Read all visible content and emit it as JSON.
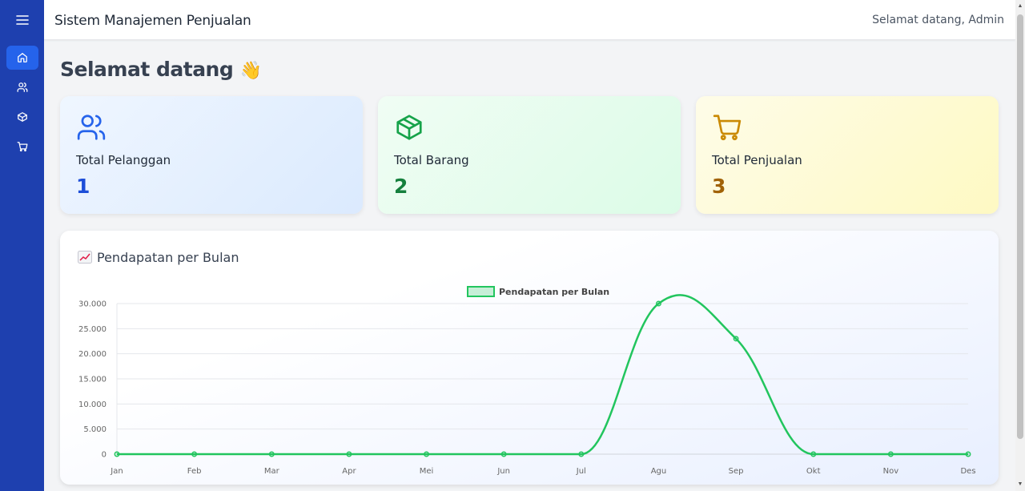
{
  "header": {
    "title": "Sistem Manajemen Penjualan",
    "welcome": "Selamat datang, Admin"
  },
  "page": {
    "title": "Selamat datang",
    "title_emoji": "👋"
  },
  "sidebar": {
    "items": [
      {
        "icon": "home-icon",
        "active": true
      },
      {
        "icon": "users-icon",
        "active": false
      },
      {
        "icon": "box-icon",
        "active": false
      },
      {
        "icon": "cart-icon",
        "active": false
      }
    ]
  },
  "stats": [
    {
      "label": "Total Pelanggan",
      "value": "1",
      "icon": "users-icon",
      "color": "#1d4ed8",
      "icon_color": "#2563eb"
    },
    {
      "label": "Total Barang",
      "value": "2",
      "icon": "box-icon",
      "color": "#15803d",
      "icon_color": "#16a34a"
    },
    {
      "label": "Total Penjualan",
      "value": "3",
      "icon": "cart-icon",
      "color": "#a16207",
      "icon_color": "#ca8a04"
    }
  ],
  "chart_card": {
    "title": "Pendapatan per Bulan",
    "emoji": "chart-increasing-icon"
  },
  "chart_data": {
    "type": "line",
    "categories": [
      "Jan",
      "Feb",
      "Mar",
      "Apr",
      "Mei",
      "Jun",
      "Jul",
      "Agu",
      "Sep",
      "Okt",
      "Nov",
      "Des"
    ],
    "series": [
      {
        "name": "Pendapatan per Bulan",
        "values": [
          0,
          0,
          0,
          0,
          0,
          0,
          0,
          30000,
          23000,
          0,
          0,
          0
        ],
        "color": "#22c55e"
      }
    ],
    "yticks": [
      "0",
      "5.000",
      "10.000",
      "15.000",
      "20.000",
      "25.000",
      "30.000"
    ],
    "ylim": [
      0,
      30000
    ],
    "grid": true,
    "legend": "top-center"
  }
}
